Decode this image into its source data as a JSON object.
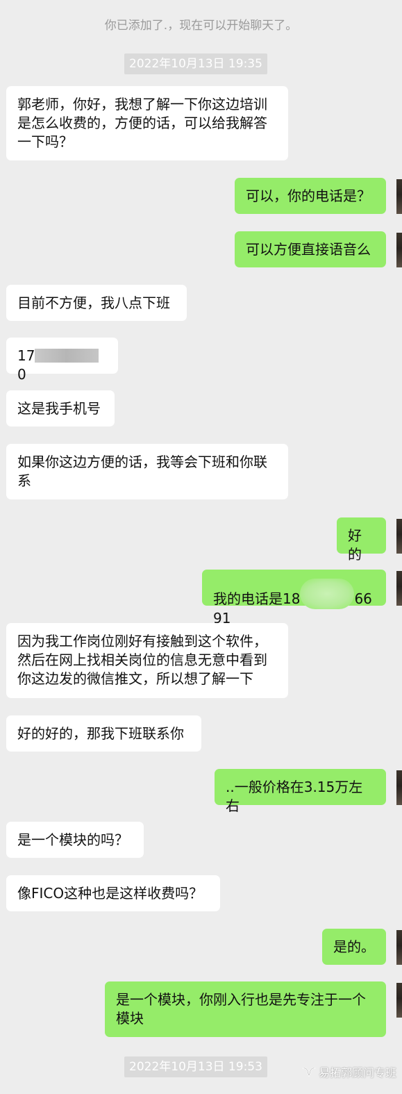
{
  "system_notice": "你已添加了.，现在可以开始聊天了。",
  "timestamps": [
    "2022年10月13日 19:35",
    "2022年10月13日 19:53"
  ],
  "messages": [
    {
      "side": "in",
      "text": "郭老师，你好，我想了解一下你这边培训是怎么收费的，方便的话，可以给我解答一下吗？"
    },
    {
      "side": "out",
      "text": "可以，你的电话是？"
    },
    {
      "side": "out",
      "text": "可以方便直接语音么"
    },
    {
      "side": "in",
      "text": "目前不方便，我八点下班"
    },
    {
      "side": "in",
      "text_prefix": "17",
      "text_suffix": "0",
      "redacted": true
    },
    {
      "side": "in",
      "text": "这是我手机号"
    },
    {
      "side": "in",
      "text": "如果你这边方便的话，我等会下班和你联系"
    },
    {
      "side": "out",
      "text": "好的"
    },
    {
      "side": "out",
      "text_prefix": "我的电话是18",
      "text_suffix": "6691",
      "redacted": true
    },
    {
      "side": "in",
      "text": "因为我工作岗位刚好有接触到这个软件，然后在网上找相关岗位的信息无意中看到你这边发的微信推文，所以想了解一下"
    },
    {
      "side": "in",
      "text": "好的好的，那我下班联系你"
    },
    {
      "side": "out",
      "text": "..一般价格在3.15万左右"
    },
    {
      "side": "in",
      "text": "是一个模块的吗？"
    },
    {
      "side": "in",
      "text": "像FICO这种也是这样收费吗？"
    },
    {
      "side": "out",
      "text": "是的。"
    },
    {
      "side": "out",
      "text": "是一个模块，你刚入行也是先专注于一个模块"
    }
  ],
  "watermark": {
    "text": "易拓郭顾问专班",
    "icon": "wechat-channel-icon"
  },
  "colors": {
    "background": "#ededed",
    "incoming_bubble": "#ffffff",
    "outgoing_bubble": "#95ec69",
    "timestamp_bg": "#dadada"
  }
}
